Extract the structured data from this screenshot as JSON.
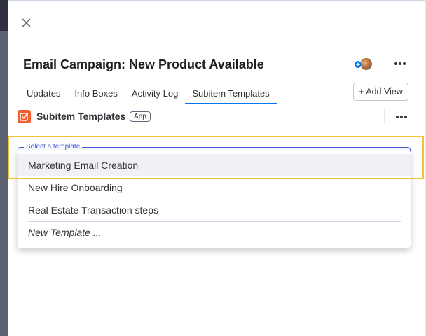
{
  "panel": {
    "title": "Email Campaign: New Product Available"
  },
  "tabs": [
    {
      "label": "Updates"
    },
    {
      "label": "Info Boxes"
    },
    {
      "label": "Activity Log"
    },
    {
      "label": "Subitem Templates"
    }
  ],
  "add_view_label": "+ Add View",
  "app": {
    "title": "Subitem Templates",
    "badge": "App",
    "accent_color": "#f65f2d"
  },
  "select": {
    "legend": "Select a template",
    "options": [
      {
        "label": "Marketing Email Creation"
      },
      {
        "label": "New Hire Onboarding"
      },
      {
        "label": "Real Estate Transaction steps"
      }
    ],
    "new_template_label": "New Template ..."
  },
  "colors": {
    "primary": "#0073ea",
    "highlight": "#f1c232"
  }
}
